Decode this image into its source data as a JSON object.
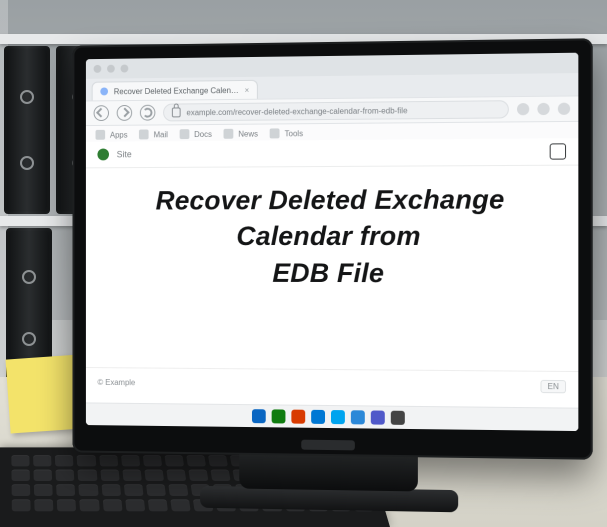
{
  "headline": {
    "line1": "Recover Deleted Exchange",
    "line2": "Calendar from",
    "line3": "EDB File"
  },
  "browser": {
    "tab_title": "Recover Deleted Exchange Calen…",
    "url_display": "example.com/recover-deleted-exchange-calendar-from-edb-file",
    "bookmarks": [
      "Apps",
      "Mail",
      "Docs",
      "News",
      "Tools"
    ]
  },
  "page": {
    "brand_label": "Site",
    "footer_left": "© Example",
    "footer_badge": "EN"
  },
  "taskbar_colors": [
    "#0a66c2",
    "#107c10",
    "#d83b01",
    "#0078d4",
    "#00a4ef",
    "#2b88d8",
    "#5059c9",
    "#444"
  ]
}
